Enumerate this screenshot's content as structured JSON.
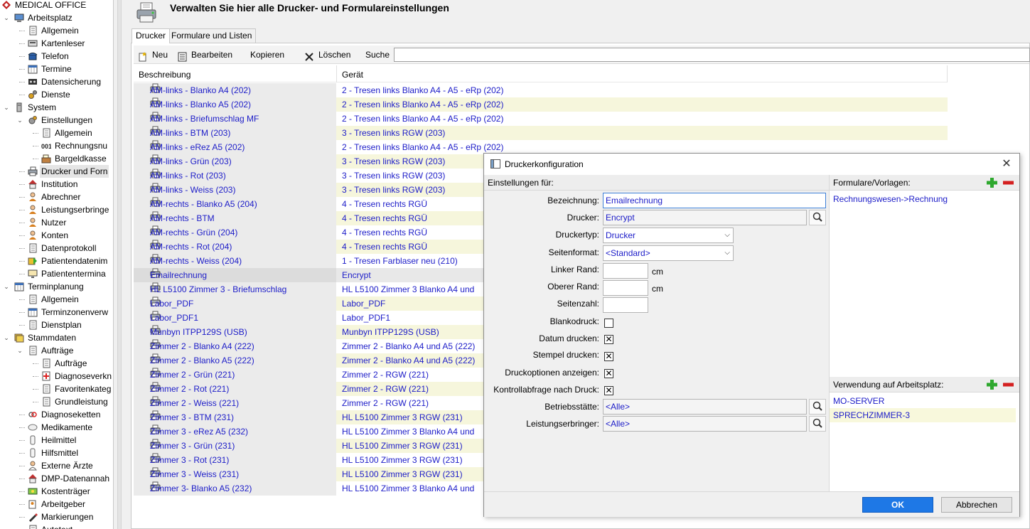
{
  "app": {
    "title": "MEDICAL OFFICE"
  },
  "tree": [
    {
      "label": "MEDICAL OFFICE",
      "depth": 0,
      "expander": "",
      "icon": "app-logo-icon"
    },
    {
      "label": "Arbeitsplatz",
      "depth": 1,
      "expander": "v",
      "icon": "computer-icon"
    },
    {
      "label": "Allgemein",
      "depth": 2,
      "expander": "",
      "icon": "document-icon"
    },
    {
      "label": "Kartenleser",
      "depth": 2,
      "expander": "",
      "icon": "card-reader-icon"
    },
    {
      "label": "Telefon",
      "depth": 2,
      "expander": "",
      "icon": "telephone-icon"
    },
    {
      "label": "Termine",
      "depth": 2,
      "expander": "",
      "icon": "calendar-icon"
    },
    {
      "label": "Datensicherung",
      "depth": 2,
      "expander": "",
      "icon": "tape-icon"
    },
    {
      "label": "Dienste",
      "depth": 2,
      "expander": "",
      "icon": "gears-icon"
    },
    {
      "label": "System",
      "depth": 1,
      "expander": "v",
      "icon": "tower-icon"
    },
    {
      "label": "Einstellungen",
      "depth": 2,
      "expander": "v",
      "icon": "settings-icon"
    },
    {
      "label": "Allgemein",
      "depth": 3,
      "expander": "",
      "icon": "document-icon"
    },
    {
      "label": "Rechnungsnu",
      "depth": 3,
      "expander": "",
      "icon": "counter-icon"
    },
    {
      "label": "Bargeldkasse",
      "depth": 3,
      "expander": "",
      "icon": "cash-register-icon"
    },
    {
      "label": "Drucker und Forn",
      "depth": 2,
      "expander": "",
      "icon": "printer-icon",
      "selected": true
    },
    {
      "label": "Institution",
      "depth": 2,
      "expander": "",
      "icon": "house-icon"
    },
    {
      "label": "Abrechner",
      "depth": 2,
      "expander": "",
      "icon": "person-icon"
    },
    {
      "label": "Leistungserbringe",
      "depth": 2,
      "expander": "",
      "icon": "person-icon"
    },
    {
      "label": "Nutzer",
      "depth": 2,
      "expander": "",
      "icon": "person-icon"
    },
    {
      "label": "Konten",
      "depth": 2,
      "expander": "",
      "icon": "person-icon"
    },
    {
      "label": "Datenprotokoll",
      "depth": 2,
      "expander": "",
      "icon": "document-icon"
    },
    {
      "label": "Patientendatenim",
      "depth": 2,
      "expander": "",
      "icon": "import-icon"
    },
    {
      "label": "Patiententermina",
      "depth": 2,
      "expander": "",
      "icon": "monitor-icon"
    },
    {
      "label": "Terminplanung",
      "depth": 1,
      "expander": "v",
      "icon": "calendar-icon"
    },
    {
      "label": "Allgemein",
      "depth": 2,
      "expander": "",
      "icon": "document-icon"
    },
    {
      "label": "Terminzonenverw",
      "depth": 2,
      "expander": "",
      "icon": "calendar-icon"
    },
    {
      "label": "Dienstplan",
      "depth": 2,
      "expander": "",
      "icon": "document-icon"
    },
    {
      "label": "Stammdaten",
      "depth": 1,
      "expander": "v",
      "icon": "stack-icon"
    },
    {
      "label": "Aufträge",
      "depth": 2,
      "expander": "v",
      "icon": "document-icon"
    },
    {
      "label": "Aufträge",
      "depth": 3,
      "expander": "",
      "icon": "document-icon"
    },
    {
      "label": "Diagnoseverkn",
      "depth": 3,
      "expander": "",
      "icon": "medical-cross-icon"
    },
    {
      "label": "Favoritenkateg",
      "depth": 3,
      "expander": "",
      "icon": "document-icon"
    },
    {
      "label": "Grundleistung",
      "depth": 3,
      "expander": "",
      "icon": "document-icon"
    },
    {
      "label": "Diagnoseketten",
      "depth": 2,
      "expander": "",
      "icon": "chain-icon"
    },
    {
      "label": "Medikamente",
      "depth": 2,
      "expander": "",
      "icon": "pill-icon"
    },
    {
      "label": "Heilmittel",
      "depth": 2,
      "expander": "",
      "icon": "remedy-icon"
    },
    {
      "label": "Hilfsmittel",
      "depth": 2,
      "expander": "",
      "icon": "remedy-icon"
    },
    {
      "label": "Externe Ärzte",
      "depth": 2,
      "expander": "",
      "icon": "doctor-icon"
    },
    {
      "label": "DMP-Datenannah",
      "depth": 2,
      "expander": "",
      "icon": "house-icon"
    },
    {
      "label": "Kostenträger",
      "depth": 2,
      "expander": "",
      "icon": "money-icon"
    },
    {
      "label": "Arbeitgeber",
      "depth": 2,
      "expander": "",
      "icon": "worker-icon"
    },
    {
      "label": "Markierungen",
      "depth": 2,
      "expander": "",
      "icon": "pen-icon"
    },
    {
      "label": "Autotext",
      "depth": 2,
      "expander": "",
      "icon": "document-icon"
    }
  ],
  "header": {
    "title": "Verwalten Sie hier alle Drucker- und Formulareinstellungen"
  },
  "tabs": [
    {
      "label": "Drucker",
      "active": true
    },
    {
      "label": "Formulare und Listen",
      "active": false
    }
  ],
  "toolbar": {
    "new_label": "Neu",
    "edit_label": "Bearbeiten",
    "copy_label": "Kopieren",
    "delete_label": "Löschen",
    "search_label": "Suche",
    "search_value": ""
  },
  "table": {
    "columns": [
      "Beschreibung",
      "Gerät"
    ],
    "rows": [
      [
        "AM-links - Blanko A4 (202)",
        "2 - Tresen links Blanko A4 - A5 - eRp (202)"
      ],
      [
        "AM-links - Blanko A5 (202)",
        "2 - Tresen links Blanko A4 - A5 - eRp (202)"
      ],
      [
        "AM-links - Briefumschlag MF",
        "2 - Tresen links Blanko A4 - A5 - eRp (202)"
      ],
      [
        "AM-links - BTM (203)",
        "3 - Tresen links RGW (203)"
      ],
      [
        "AM-links - eRez A5 (202)",
        "2 - Tresen links Blanko A4 - A5 - eRp (202)"
      ],
      [
        "AM-links - Grün (203)",
        "3 - Tresen links RGW (203)"
      ],
      [
        "AM-links - Rot (203)",
        "3 - Tresen links RGW (203)"
      ],
      [
        "AM-links - Weiss (203)",
        "3 - Tresen links RGW (203)"
      ],
      [
        "AM-rechts - Blanko A5 (204)",
        "4 - Tresen rechts RGÜ"
      ],
      [
        "AM-rechts - BTM",
        "4 - Tresen rechts RGÜ"
      ],
      [
        "AM-rechts - Grün (204)",
        "4 - Tresen rechts RGÜ"
      ],
      [
        "AM-rechts - Rot (204)",
        "4 - Tresen rechts RGÜ"
      ],
      [
        "AM-rechts - Weiss (204)",
        "1 - Tresen Farblaser neu (210)"
      ],
      [
        "Emailrechnung",
        "Encrypt"
      ],
      [
        "HL L5100 Zimmer 3 - Briefumschlag",
        "HL L5100 Zimmer 3 Blanko A4 und"
      ],
      [
        "Labor_PDF",
        "Labor_PDF"
      ],
      [
        "Labor_PDF1",
        "Labor_PDF1"
      ],
      [
        "Munbyn ITPP129S (USB)",
        "Munbyn ITPP129S (USB)"
      ],
      [
        "Zimmer 2 - Blanko A4 (222)",
        "Zimmer 2 - Blanko A4 und A5 (222)"
      ],
      [
        "Zimmer 2 - Blanko A5 (222)",
        "Zimmer 2 - Blanko A4 und A5 (222)"
      ],
      [
        "Zimmer 2 - Grün (221)",
        "Zimmer 2 - RGW (221)"
      ],
      [
        "Zimmer 2 - Rot (221)",
        "Zimmer 2 - RGW (221)"
      ],
      [
        "Zimmer 2 - Weiss (221)",
        "Zimmer 2 - RGW (221)"
      ],
      [
        "Zimmer 3 - BTM (231)",
        "HL L5100 Zimmer 3 RGW (231)"
      ],
      [
        "Zimmer 3 - eRez A5 (232)",
        "HL L5100 Zimmer 3 Blanko A4 und"
      ],
      [
        "Zimmer 3 - Grün (231)",
        "HL L5100 Zimmer 3 RGW (231)"
      ],
      [
        "Zimmer 3 - Rot (231)",
        "HL L5100 Zimmer 3 RGW (231)"
      ],
      [
        "Zimmer 3 - Weiss (231)",
        "HL L5100 Zimmer 3 RGW (231)"
      ],
      [
        "Zimmer 3- Blanko A5 (232)",
        "HL L5100 Zimmer 3 Blanko A4 und"
      ]
    ],
    "selected_row": "Emailrechnung"
  },
  "dialog": {
    "title": "Druckerkonfiguration",
    "left_header": "Einstellungen für:",
    "fields": {
      "bezeichnung_label": "Bezeichnung:",
      "bezeichnung_value": "Emailrechnung",
      "drucker_label": "Drucker:",
      "drucker_value": "Encrypt",
      "druckertyp_label": "Druckertyp:",
      "druckertyp_value": "Drucker",
      "seitenformat_label": "Seitenformat:",
      "seitenformat_value": "<Standard>",
      "linker_rand_label": "Linker Rand:",
      "linker_rand_value": "",
      "linker_rand_unit": "cm",
      "oberer_rand_label": "Oberer Rand:",
      "oberer_rand_value": "",
      "oberer_rand_unit": "cm",
      "seitenzahl_label": "Seitenzahl:",
      "seitenzahl_value": "",
      "blankodruck_label": "Blankodruck:",
      "blankodruck_checked": false,
      "datum_label": "Datum drucken:",
      "datum_checked": true,
      "stempel_label": "Stempel drucken:",
      "stempel_checked": true,
      "druckoptionen_label": "Druckoptionen anzeigen:",
      "druckoptionen_checked": true,
      "kontrollabfrage_label": "Kontrollabfrage nach Druck:",
      "kontrollabfrage_checked": true,
      "betriebsstaette_label": "Betriebsstätte:",
      "betriebsstaette_value": "<Alle>",
      "leistungserbringer_label": "Leistungserbringer:",
      "leistungserbringer_value": "<Alle>"
    },
    "formulare_header": "Formulare/Vorlagen:",
    "formulare_items": [
      "Rechnungswesen->Rechnung"
    ],
    "verwendung_header": "Verwendung auf Arbeitsplatz:",
    "verwendung_items": [
      "MO-SERVER",
      "SPRECHZIMMER-3"
    ],
    "ok_label": "OK",
    "cancel_label": "Abbrechen"
  },
  "colors": {
    "link_text": "#1c1cc8",
    "alt_row": "#f6f6dc",
    "ok_button": "#1e78e6",
    "plus_green": "#2ea82e",
    "minus_red": "#d42020"
  }
}
